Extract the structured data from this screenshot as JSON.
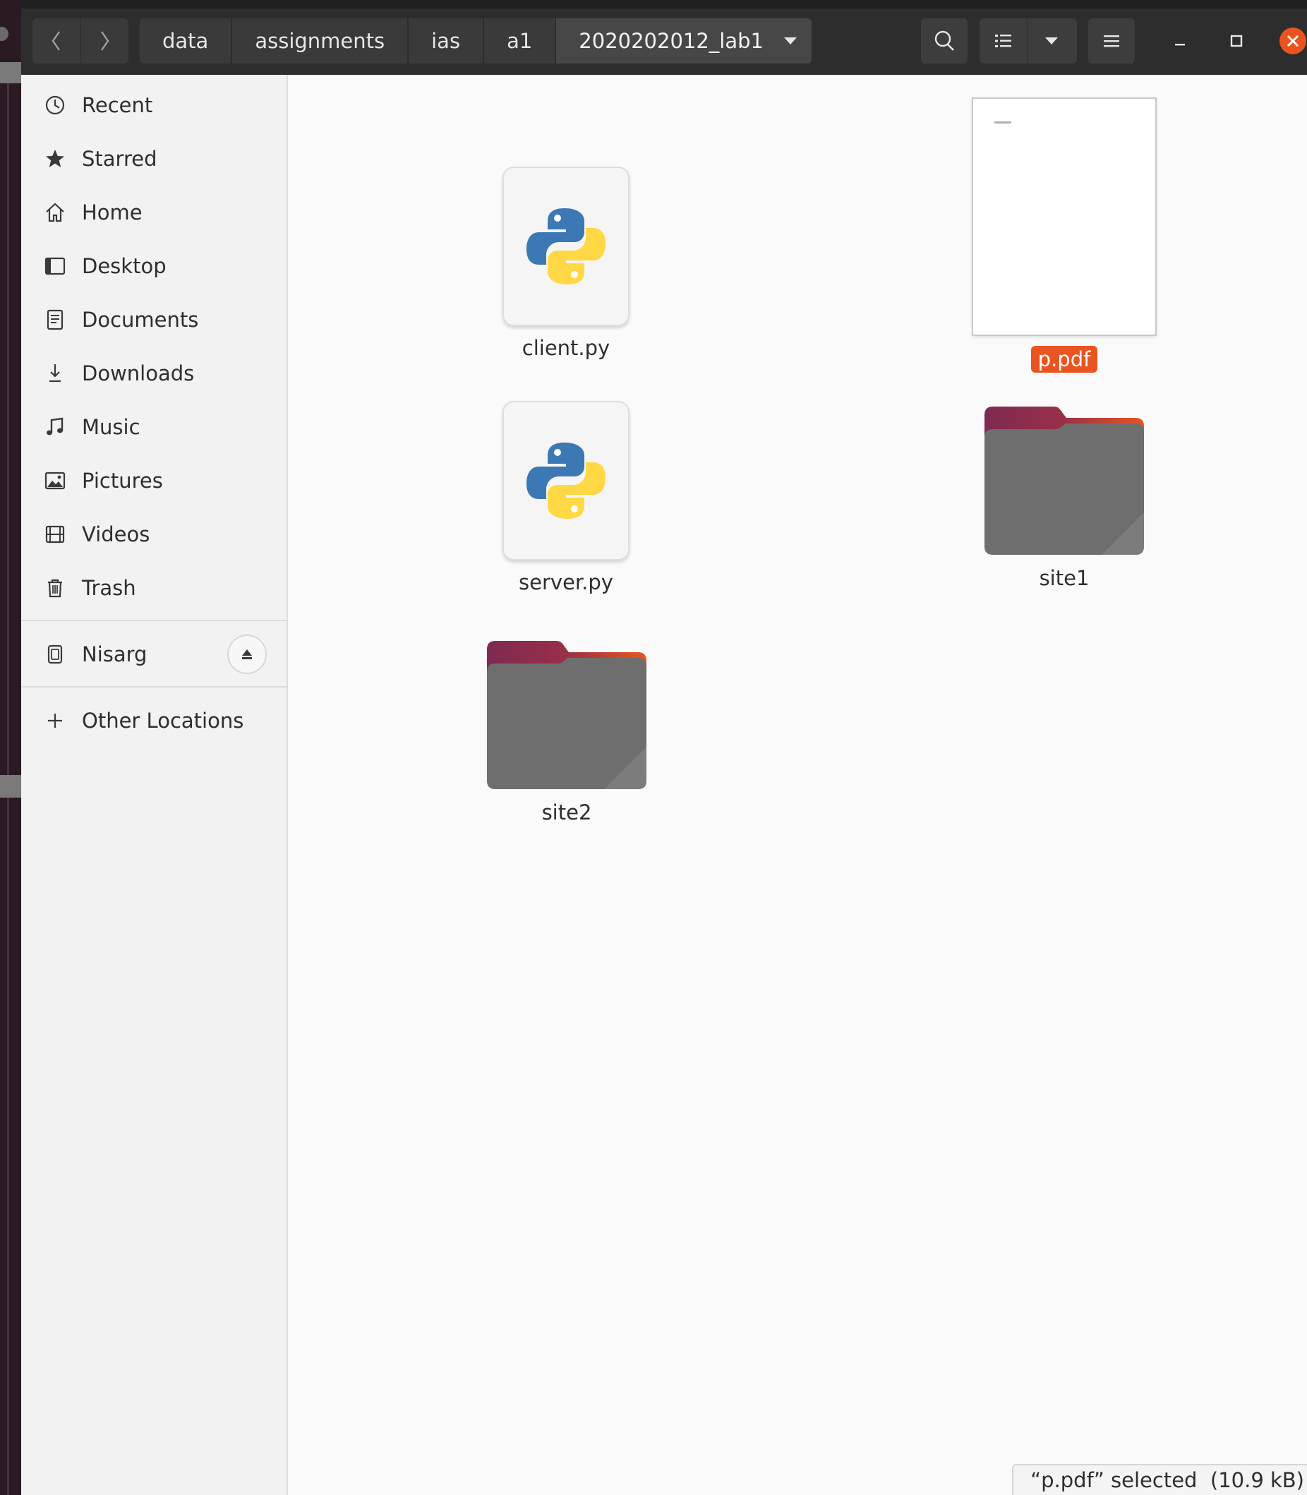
{
  "breadcrumbs": [
    "data",
    "assignments",
    "ias",
    "a1",
    "2020202012_lab1"
  ],
  "sidebar": {
    "items": [
      {
        "label": "Recent",
        "icon": "clock-icon"
      },
      {
        "label": "Starred",
        "icon": "star-icon"
      },
      {
        "label": "Home",
        "icon": "home-icon"
      },
      {
        "label": "Desktop",
        "icon": "desktop-icon"
      },
      {
        "label": "Documents",
        "icon": "document-icon"
      },
      {
        "label": "Downloads",
        "icon": "download-icon"
      },
      {
        "label": "Music",
        "icon": "music-icon"
      },
      {
        "label": "Pictures",
        "icon": "picture-icon"
      },
      {
        "label": "Videos",
        "icon": "video-icon"
      },
      {
        "label": "Trash",
        "icon": "trash-icon"
      }
    ],
    "device": {
      "label": "Nisarg",
      "icon": "drive-icon"
    },
    "other": {
      "label": "Other Locations",
      "icon": "plus-icon"
    }
  },
  "files": [
    {
      "name": "client.py",
      "type": "python"
    },
    {
      "name": "p.pdf",
      "type": "pdf",
      "selected": true
    },
    {
      "name": "server.py",
      "type": "python"
    },
    {
      "name": "site1",
      "type": "folder"
    },
    {
      "name": "site2",
      "type": "folder"
    }
  ],
  "status": "“p.pdf” selected  (10.9 kB)",
  "colors": {
    "accent": "#e95420",
    "headerbar": "#2d2d2d",
    "sidebar": "#f2f2f2",
    "folder_body": "#6e6e6e",
    "folder_tab_start": "#7d2a52",
    "folder_tab_end": "#e95420",
    "python_blue": "#3c78b4",
    "python_yellow": "#ffd845"
  }
}
